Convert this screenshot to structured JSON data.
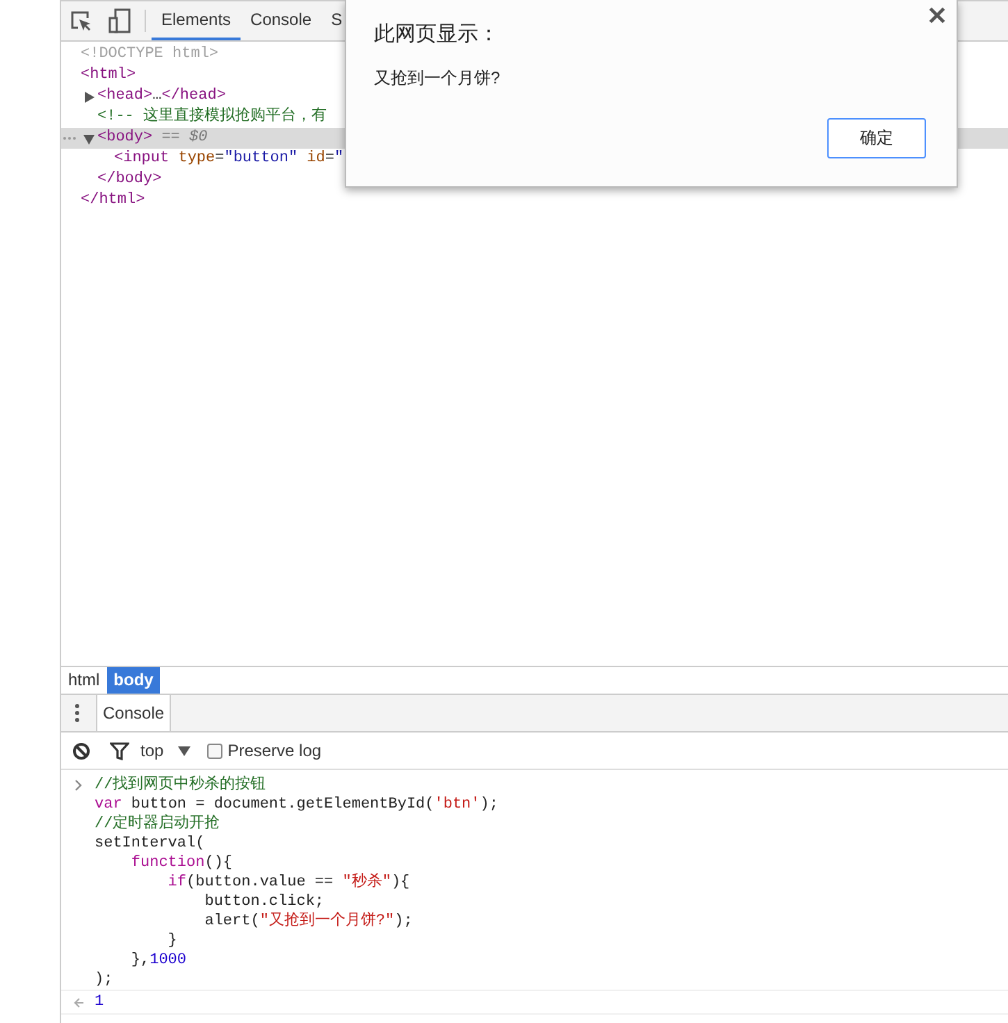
{
  "devtools": {
    "tabs": [
      {
        "label": "Elements",
        "selected": true
      },
      {
        "label": "Console",
        "selected": false
      },
      {
        "label": "S",
        "selected": false
      }
    ],
    "dom_tree": [
      {
        "tokens": [
          {
            "kind": "doctype",
            "text": "<!DOCTYPE html>"
          }
        ]
      },
      {
        "tokens": [
          {
            "kind": "tag",
            "text": "<html>"
          }
        ],
        "children": [
          {
            "expanded": false,
            "tokens": [
              {
                "kind": "tag",
                "text": "<head>"
              },
              {
                "kind": "plain",
                "text": "…"
              },
              {
                "kind": "tag",
                "text": "</head>"
              }
            ]
          },
          {
            "tokens": [
              {
                "kind": "comment",
                "text": "<!-- 这里直接模拟抢购平台，有"
              }
            ]
          },
          {
            "expanded": true,
            "selected": true,
            "tokens": [
              {
                "kind": "tag",
                "text": "<body>"
              },
              {
                "kind": "marker",
                "text": " == $0"
              }
            ],
            "children": [
              {
                "tokens": [
                  {
                    "kind": "tag",
                    "text": "<input "
                  },
                  {
                    "kind": "attr",
                    "text": "type"
                  },
                  {
                    "kind": "plain",
                    "text": "="
                  },
                  {
                    "kind": "value",
                    "text": "\"button\" "
                  },
                  {
                    "kind": "attr",
                    "text": "id"
                  },
                  {
                    "kind": "plain",
                    "text": "="
                  },
                  {
                    "kind": "value",
                    "text": "\""
                  }
                ]
              }
            ],
            "closing": [
              {
                "kind": "tag",
                "text": "</body>"
              }
            ]
          }
        ],
        "closing": [
          {
            "kind": "tag",
            "text": "</html>"
          }
        ]
      }
    ],
    "breadcrumbs": [
      {
        "label": "html",
        "selected": false
      },
      {
        "label": "body",
        "selected": true
      }
    ],
    "drawer": {
      "tabs": [
        {
          "label": "Console",
          "selected": true
        }
      ],
      "context": "top",
      "preserve_log": {
        "label": "Preserve log",
        "checked": false
      },
      "input_lines": [
        [
          {
            "kind": "comment",
            "text": "//找到网页中秒杀的按钮"
          }
        ],
        [
          {
            "kind": "keyword",
            "text": "var"
          },
          {
            "kind": "plain",
            "text": " button = document.getElementById("
          },
          {
            "kind": "string",
            "text": "'btn'"
          },
          {
            "kind": "plain",
            "text": ");"
          }
        ],
        [
          {
            "kind": "comment",
            "text": "//定时器启动开抢"
          }
        ],
        [
          {
            "kind": "plain",
            "text": "setInterval("
          }
        ],
        [
          {
            "kind": "keyword",
            "text": "    function"
          },
          {
            "kind": "plain",
            "text": "(){"
          }
        ],
        [
          {
            "kind": "keyword",
            "text": "        if"
          },
          {
            "kind": "plain",
            "text": "(button.value == "
          },
          {
            "kind": "string",
            "text": "\"秒杀\""
          },
          {
            "kind": "plain",
            "text": "){"
          }
        ],
        [
          {
            "kind": "plain",
            "text": "            button.click;"
          }
        ],
        [
          {
            "kind": "plain",
            "text": "            alert("
          },
          {
            "kind": "string",
            "text": "\"又抢到一个月饼?\""
          },
          {
            "kind": "plain",
            "text": ");"
          }
        ],
        [
          {
            "kind": "plain",
            "text": "        }"
          }
        ],
        [
          {
            "kind": "plain",
            "text": "    },"
          },
          {
            "kind": "number",
            "text": "1000"
          }
        ],
        [
          {
            "kind": "plain",
            "text": ");"
          }
        ]
      ],
      "result": "1"
    }
  },
  "dialog": {
    "title": "此网页显示：",
    "message": "又抢到一个月饼?",
    "ok_button": "确定"
  }
}
